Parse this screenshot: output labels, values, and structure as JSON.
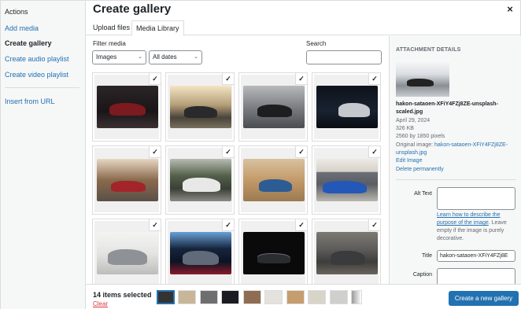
{
  "menu": {
    "heading": "Actions",
    "items": [
      {
        "label": "Add media"
      },
      {
        "label": "Create gallery"
      },
      {
        "label": "Create audio playlist"
      },
      {
        "label": "Create video playlist"
      },
      {
        "label": "Insert from URL"
      }
    ]
  },
  "modal": {
    "title": "Create gallery",
    "close_glyph": "×"
  },
  "tabs": [
    {
      "label": "Upload files"
    },
    {
      "label": "Media Library"
    }
  ],
  "filters": {
    "label": "Filter media",
    "type_value": "Images",
    "date_value": "All dates",
    "search_label": "Search",
    "search_value": ""
  },
  "grid": {
    "check_glyph": "✓",
    "items": [
      {
        "scene": "dark garage red car",
        "bg": "#1f1a1c",
        "car": "#7b1a1f"
      },
      {
        "scene": "sunset road black car",
        "bg": "#b59f7a",
        "car": "#2a2a2c"
      },
      {
        "scene": "city street black car",
        "bg": "#7c7f84",
        "car": "#1d1e20"
      },
      {
        "scene": "dark studio silver car",
        "bg": "#121820",
        "car": "#c5c8cc"
      },
      {
        "scene": "autumn forest red car",
        "bg": "#8a6a4c",
        "car": "#a3242b"
      },
      {
        "scene": "forest road white car",
        "bg": "#54604a",
        "car": "#e8e8e6"
      },
      {
        "scene": "desert blue car",
        "bg": "#c39a69",
        "car": "#2d5c95"
      },
      {
        "scene": "warehouse blue car",
        "bg": "#d6d2c8",
        "car": "#2458b8"
      },
      {
        "scene": "white wall grey car",
        "bg": "#e4e4e2",
        "car": "#8e9196"
      },
      {
        "scene": "neon tunnel grey car",
        "bg": "#16243c",
        "car": "#606a78"
      },
      {
        "scene": "black studio car",
        "bg": "#0a0a0b",
        "car": "#2b2c30"
      },
      {
        "scene": "car meet grey car",
        "bg": "#5e5d5b",
        "car": "#3a3b3d"
      }
    ]
  },
  "details": {
    "heading": "ATTACHMENT DETAILS",
    "filename_line1": "hakon-sataoen-XFiY4FZj8ZE-unsplash-",
    "filename_line2": "scaled.jpg",
    "date": "April 29, 2024",
    "size": "326 KB",
    "dimensions": "2560 by 1850 pixels",
    "original_prefix": "Original image:",
    "original_link1": "hakon-sataoen-XFiY4FZj8ZE-",
    "original_link2": "unsplash.jpg",
    "edit_link": "Edit Image",
    "delete_link": "Delete permanently",
    "alt_label": "Alt Text",
    "alt_value": "",
    "alt_help_link1": "Learn how to describe the",
    "alt_help_link2": "purpose of the image",
    "alt_help_rest1": ". Leave",
    "alt_help_rest2": "empty if the image is purely",
    "alt_help_rest3": "decorative.",
    "title_label": "Title",
    "title_value": "hakon-sataoen-XFiY4FZj8E",
    "caption_label": "Caption",
    "caption_value": ""
  },
  "footer": {
    "count": "14 items selected",
    "clear": "Clear",
    "button": "Create a new gallery",
    "selection": [
      {
        "bg": "#333"
      },
      {
        "bg": "#c8b699"
      },
      {
        "bg": "#6e6e70"
      },
      {
        "bg": "#1a1c22"
      },
      {
        "bg": "#8e6d52"
      },
      {
        "bg": "#e4e2dd"
      },
      {
        "bg": "#c69d6d"
      },
      {
        "bg": "#d9d4c8"
      },
      {
        "bg": "#cfcfcd"
      }
    ]
  },
  "colors": {
    "accent": "#2271b1",
    "danger": "#d63638"
  }
}
